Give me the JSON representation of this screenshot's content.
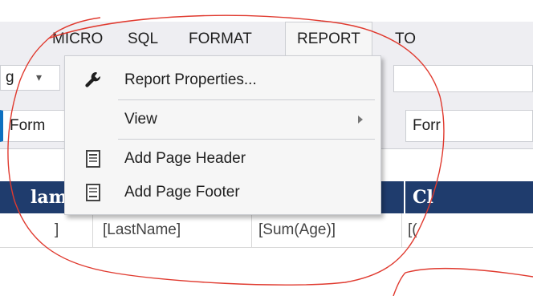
{
  "menubar": {
    "items": [
      "MICRO",
      "SQL",
      "FORMAT",
      "REPORT",
      "TO"
    ],
    "active": "REPORT"
  },
  "toolbar": {
    "combo_value": "g"
  },
  "tabs": {
    "left_label": "Form",
    "right_label": "Forr"
  },
  "table": {
    "header_left": "lam",
    "header_right": "Cl",
    "cells": [
      "]",
      "[LastName]",
      "[Sum(Age)]",
      "[("
    ]
  },
  "dropdown": {
    "items": [
      {
        "label": "Report Properties...",
        "icon": "wrench-icon"
      },
      {
        "label": "View",
        "icon": ""
      },
      {
        "label": "Add Page Header",
        "icon": "page-header-icon"
      },
      {
        "label": "Add Page Footer",
        "icon": "page-footer-icon"
      }
    ]
  },
  "colors": {
    "menubar_bg": "#eeeef2",
    "header_bg": "#1f3c6d",
    "tab_accent": "#0e70c0",
    "annotation": "#e03a2f"
  }
}
